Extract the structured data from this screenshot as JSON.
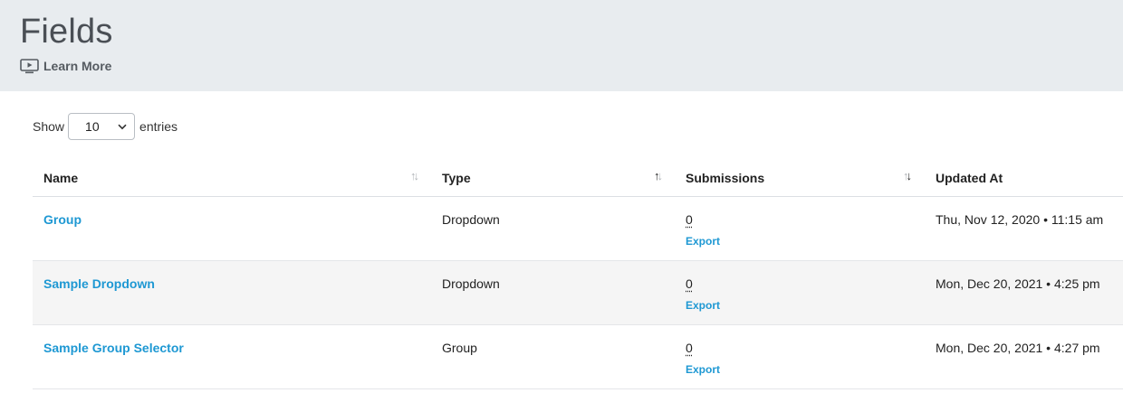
{
  "header": {
    "title": "Fields",
    "learn_more_label": "Learn More",
    "learn_more_icon": "video-play-icon"
  },
  "entries_control": {
    "show_label": "Show",
    "selected_value": "10",
    "entries_label": "entries"
  },
  "table": {
    "columns": [
      {
        "label": "Name",
        "sort_state": "none"
      },
      {
        "label": "Type",
        "sort_state": "ascending"
      },
      {
        "label": "Submissions",
        "sort_state": "descending"
      },
      {
        "label": "Updated At",
        "sort_state": "none"
      }
    ],
    "rows": [
      {
        "name": "Group",
        "type": "Dropdown",
        "submissions": "0",
        "export_label": "Export",
        "updated_at": "Thu, Nov 12, 2020 • 11:15 am"
      },
      {
        "name": "Sample Dropdown",
        "type": "Dropdown",
        "submissions": "0",
        "export_label": "Export",
        "updated_at": "Mon, Dec 20, 2021 • 4:25 pm"
      },
      {
        "name": "Sample Group Selector",
        "type": "Group",
        "submissions": "0",
        "export_label": "Export",
        "updated_at": "Mon, Dec 20, 2021 • 4:27 pm"
      }
    ]
  },
  "colors": {
    "header_bg": "#e8ecef",
    "link": "#1e98d3",
    "alt_row_bg": "#f5f5f5"
  }
}
